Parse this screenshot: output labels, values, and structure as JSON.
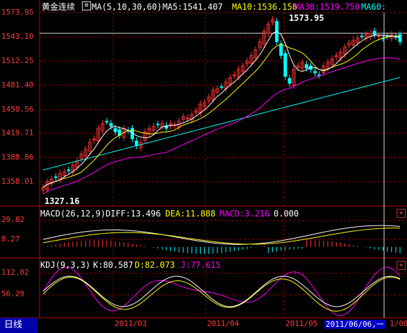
{
  "window": {
    "tab_label": "日线"
  },
  "main_panel": {
    "symbol": "黄金连续",
    "ma_params": "MA(5,10,30,60)",
    "ma5": "MA5:1541.407",
    "ma10": "MA10:1536.158",
    "ma30": "MA30:1519.750",
    "ma60": "MA60:",
    "y_ticks": [
      "1573.95",
      "1543.10",
      "1512.25",
      "1481.40",
      "1450.56",
      "1419.71",
      "1388.86",
      "1358.01"
    ],
    "high_label": "1573.95",
    "low_label": "1327.16"
  },
  "macd_panel": {
    "title": "MACD(26,12,9)",
    "diff": "DIFF:13.496",
    "dea": "DEA:11.888",
    "macd": "MACD:3.216",
    "extra": "0.000",
    "y_ticks": [
      "29.82",
      "8.27"
    ]
  },
  "kdj_panel": {
    "title": "KDJ(9,3,3)",
    "k": "K:80.587",
    "d": "D:82.073",
    "j": "J:77.615",
    "y_ticks": [
      "112.02",
      "56.29"
    ]
  },
  "x_axis": {
    "labels": [
      "2011/03",
      "2011/04",
      "2011/05"
    ],
    "cursor_date": "2011/06/06,一",
    "tail_label": "1/08"
  },
  "colors": {
    "up": "#ff3232",
    "down": "#00ffff",
    "ma5": "#ffffff",
    "ma10": "#ffff00",
    "ma30": "#ff00ff",
    "ma60": "#00ffff",
    "grid": "#a00000"
  },
  "chart_data": {
    "type": "candlestick",
    "title": "黄金连续",
    "ylim": [
      1327.16,
      1573.95
    ],
    "x_labels": [
      "2011/03",
      "2011/04",
      "2011/05"
    ],
    "high": 1573.95,
    "low": 1327.16,
    "series": [
      {
        "name": "MA5",
        "last": 1541.407
      },
      {
        "name": "MA10",
        "last": 1536.158
      },
      {
        "name": "MA30",
        "last": 1519.75
      },
      {
        "name": "MACD DIFF",
        "last": 13.496
      },
      {
        "name": "MACD DEA",
        "last": 11.888
      },
      {
        "name": "MACD",
        "last": 3.216
      },
      {
        "name": "KDJ K",
        "last": 80.587
      },
      {
        "name": "KDJ D",
        "last": 82.073
      },
      {
        "name": "KDJ J",
        "last": 77.615
      }
    ]
  }
}
